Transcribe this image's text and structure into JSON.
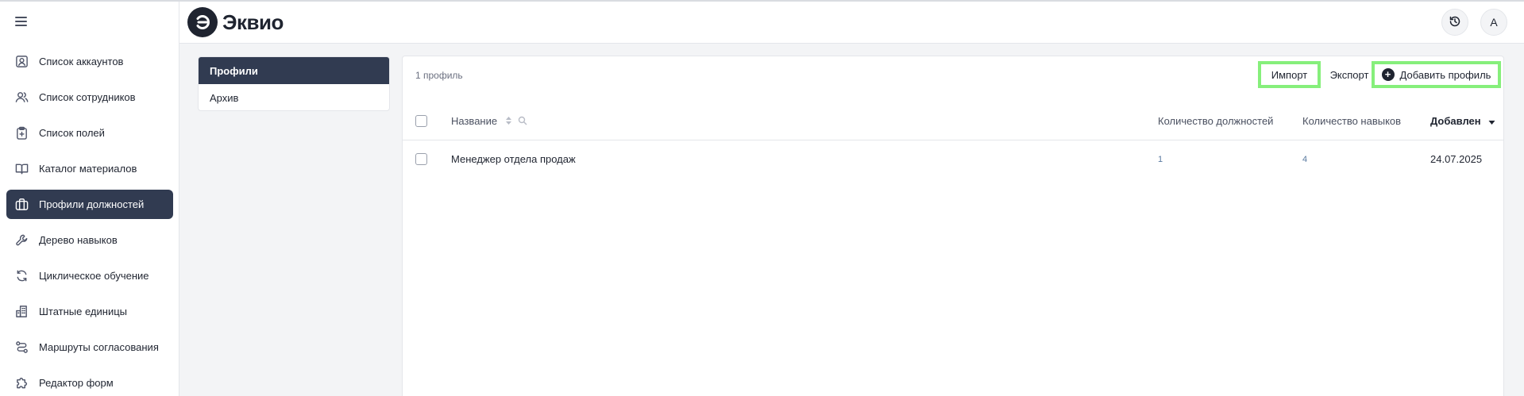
{
  "app": {
    "name": "Эквио"
  },
  "header": {
    "avatar_letter": "А"
  },
  "sidebar": {
    "items": [
      {
        "label": "Список аккаунтов",
        "icon": "account-card-icon"
      },
      {
        "label": "Список сотрудников",
        "icon": "users-icon"
      },
      {
        "label": "Список полей",
        "icon": "clipboard-plus-icon"
      },
      {
        "label": "Каталог материалов",
        "icon": "book-open-icon"
      },
      {
        "label": "Профили должностей",
        "icon": "briefcase-icon",
        "active": true
      },
      {
        "label": "Дерево навыков",
        "icon": "wrench-icon"
      },
      {
        "label": "Циклическое обучение",
        "icon": "refresh-icon"
      },
      {
        "label": "Штатные единицы",
        "icon": "building-icon"
      },
      {
        "label": "Маршруты согласования",
        "icon": "route-icon"
      },
      {
        "label": "Редактор форм",
        "icon": "puzzle-icon"
      }
    ]
  },
  "subtabs": {
    "profiles": "Профили",
    "archive": "Архив"
  },
  "toolbar": {
    "count": "1 профиль",
    "import_label": "Импорт",
    "export_label": "Экспорт",
    "add_label": "Добавить профиль"
  },
  "table": {
    "columns": {
      "name": "Название",
      "positions": "Количество должностей",
      "skills": "Количество навыков",
      "added": "Добавлен"
    },
    "rows": [
      {
        "name": "Менеджер отдела продаж",
        "positions": "1",
        "skills": "4",
        "added": "24.07.2025"
      }
    ]
  },
  "colors": {
    "accent": "#313b51",
    "highlight": "#86ef7b",
    "link": "#5a7aa0"
  }
}
